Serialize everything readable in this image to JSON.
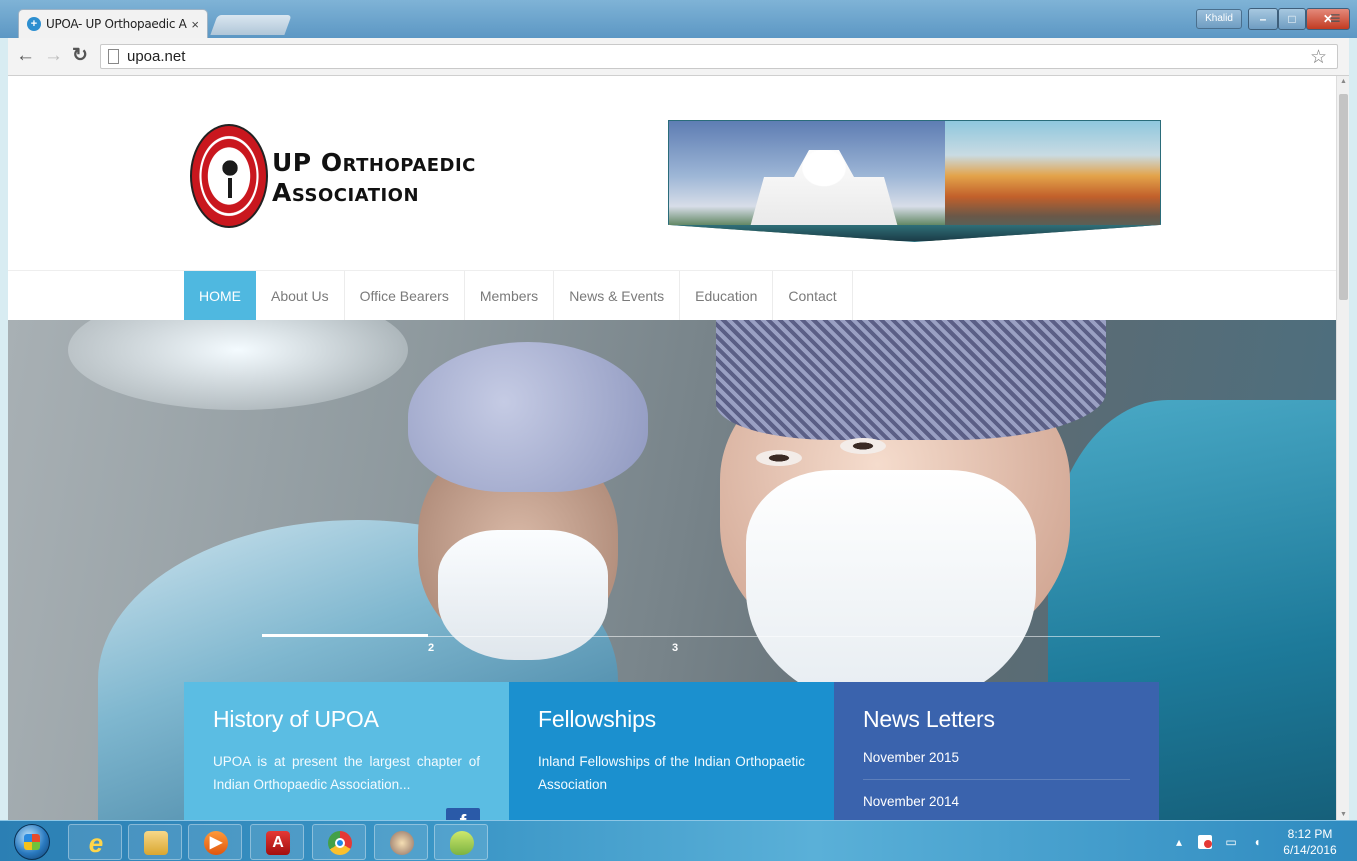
{
  "browser": {
    "tab_title": "UPOA- UP Orthopaedic A",
    "tab_close": "×",
    "url": "upoa.net",
    "user_name": "Khalid",
    "nav_icons": [
      "back-arrow-icon",
      "forward-arrow-icon",
      "reload-icon",
      "page-icon",
      "star-icon",
      "menu-icon"
    ]
  },
  "site": {
    "logo_line1": "UP Orthopaedic",
    "logo_line2": "Association",
    "brand_color": "#4fb8e0",
    "nav": [
      {
        "label": "HOME",
        "active": true
      },
      {
        "label": "About Us"
      },
      {
        "label": "Office Bearers"
      },
      {
        "label": "Members"
      },
      {
        "label": "News & Events"
      },
      {
        "label": "Education"
      },
      {
        "label": "Contact"
      }
    ],
    "slider": {
      "current": "2",
      "next": "3"
    },
    "boxes": {
      "history": {
        "title": "History of UPOA",
        "text": "UPOA is at present the largest chapter of Indian Orthopaedic Association..."
      },
      "fellowships": {
        "title": "Fellowships",
        "text": "Inland Fellowships of the Indian Orthopaetic Association"
      },
      "newsletters": {
        "title": "News Letters",
        "items": [
          "November 2015",
          "November 2014"
        ]
      }
    }
  },
  "taskbar": {
    "time": "8:12 PM",
    "date": "6/14/2016",
    "apps": [
      "internet-explorer",
      "file-explorer",
      "media-player",
      "adobe-reader",
      "chrome",
      "clock-app",
      "leaf-app"
    ]
  }
}
